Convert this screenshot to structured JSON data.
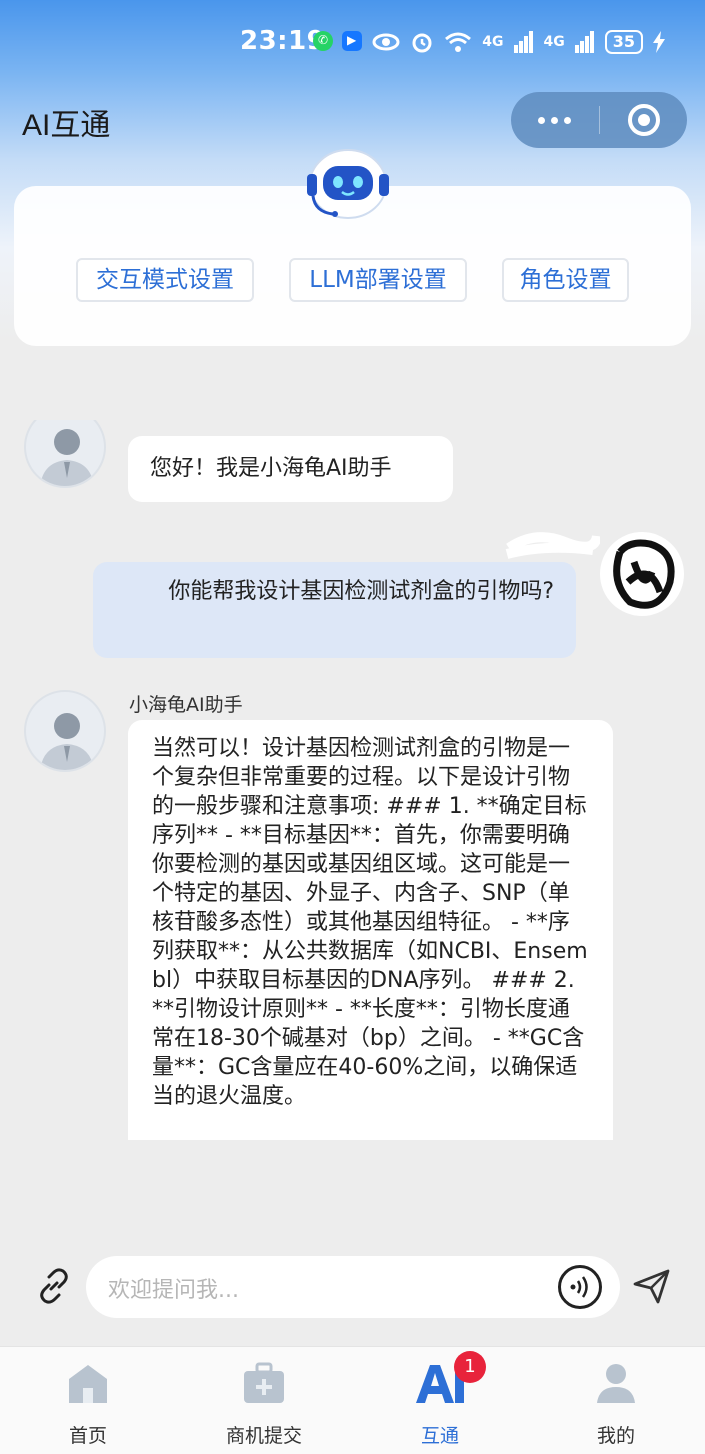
{
  "status_bar": {
    "time": "23:19",
    "signal_1": "4G",
    "signal_2": "4G",
    "battery": "35"
  },
  "nav": {
    "title": "AI互通"
  },
  "settings": {
    "buttons": [
      "交互模式设置",
      "LLM部署设置",
      "角色设置"
    ]
  },
  "chat": {
    "messages": [
      {
        "role": "ai",
        "text": "您好！我是小海龟AI助手"
      },
      {
        "role": "user",
        "text": "你能帮我设计基因检测试剂盒的引物吗?"
      },
      {
        "role": "ai",
        "sender": "小海龟AI助手",
        "text": "当然可以！设计基因检测试剂盒的引物是一个复杂但非常重要的过程。以下是设计引物的一般步骤和注意事项: ### 1. **确定目标序列** - **目标基因**：首先，你需要明确你要检测的基因或基因组区域。这可能是一个特定的基因、外显子、内含子、SNP（单核苷酸多态性）或其他基因组特征。 - **序列获取**：从公共数据库（如NCBI、Ensembl）中获取目标基因的DNA序列。 ### 2. **引物设计原则** - **长度**：引物长度通常在18-30个碱基对（bp）之间。 - **GC含量**：GC含量应在40-60%之间，以确保适当的退火温度。"
      }
    ]
  },
  "input": {
    "placeholder": "欢迎提问我..."
  },
  "tabs": [
    {
      "label": "首页",
      "icon": "home-icon"
    },
    {
      "label": "商机提交",
      "icon": "briefcase-icon"
    },
    {
      "label": "互通",
      "icon": "ai-icon",
      "badge": "1",
      "active": true
    },
    {
      "label": "我的",
      "icon": "profile-icon"
    }
  ],
  "colors": {
    "accent": "#2d6fd6",
    "user_bubble": "#dde7f7",
    "badge": "#e8233b"
  }
}
